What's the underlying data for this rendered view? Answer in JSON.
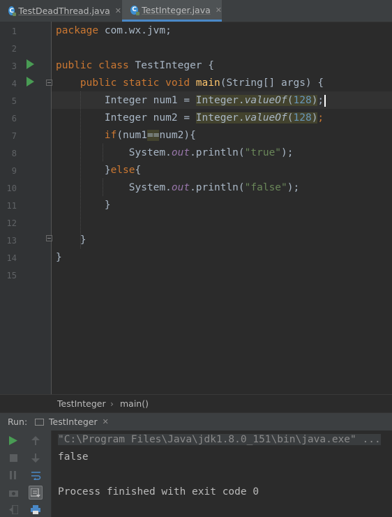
{
  "tabs": [
    {
      "icon": "java-class-icon",
      "label": "TestDeadThread.java",
      "active": false
    },
    {
      "icon": "java-class-icon",
      "label": "TestInteger.java",
      "active": true
    }
  ],
  "line_numbers": [
    "1",
    "2",
    "3",
    "4",
    "5",
    "6",
    "7",
    "8",
    "9",
    "10",
    "11",
    "12",
    "13",
    "14",
    "15"
  ],
  "code": {
    "l1": {
      "kw": "package",
      "rest": " com.wx.jvm;"
    },
    "l3": {
      "kw": "public class",
      "name": "TestInteger",
      "rest": " {"
    },
    "l4": {
      "kw": "public static void",
      "method": "main",
      "rest": "(String[] args) {"
    },
    "l5": {
      "type": "Integer num1 = ",
      "cls": "Integer.",
      "call": "valueOf",
      "open": "(",
      "arg": "128",
      "close": ")",
      "end": ";"
    },
    "l6": {
      "type": "Integer num2 = ",
      "cls": "Integer.",
      "call": "valueOf",
      "open": "(",
      "arg": "128",
      "close": ")",
      "end": ";"
    },
    "l7": {
      "kw": "if",
      "a": "(num1",
      "op": "==",
      "b": "num2){"
    },
    "l8": {
      "obj": "System.",
      "field": "out",
      "call": ".println(",
      "str": "\"true\"",
      "end": ");"
    },
    "l9": {
      "brace": "}",
      "kw": "else",
      "rest": "{"
    },
    "l10": {
      "obj": "System.",
      "field": "out",
      "call": ".println(",
      "str": "\"false\"",
      "end": ");"
    },
    "l11": "}",
    "l13": "}",
    "l14": "}"
  },
  "breadcrumb": {
    "class": "TestInteger",
    "separator": "›",
    "method": "main()"
  },
  "run_panel": {
    "label": "Run:",
    "tab_label": "TestInteger",
    "output": {
      "command": "\"C:\\Program Files\\Java\\jdk1.8.0_151\\bin\\java.exe\" ...",
      "result": "false",
      "exit": "Process finished with exit code 0"
    },
    "toolbar": [
      "run-icon",
      "stop-icon",
      "pause-icon",
      "camera-icon",
      "exit-icon",
      "up-arrow-icon",
      "down-arrow-icon",
      "soft-wrap-icon",
      "scroll-to-end-icon",
      "print-icon"
    ]
  },
  "colors": {
    "keyword": "#cc7832",
    "method": "#ffc66d",
    "number": "#6897bb",
    "string": "#6a8759",
    "field": "#9876aa",
    "text": "#a9b7c6",
    "background": "#2b2b2b",
    "gutter": "#313335",
    "run_marker": "#499c54"
  }
}
